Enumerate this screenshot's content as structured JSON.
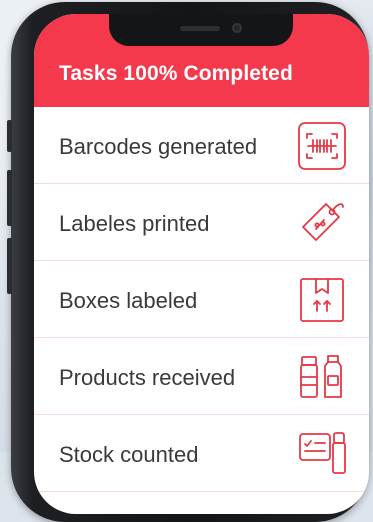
{
  "header": {
    "title": "Tasks 100% Completed"
  },
  "tasks": [
    {
      "label": "Barcodes generated",
      "icon": "barcode-scan-icon"
    },
    {
      "label": "Labeles printed",
      "icon": "price-tag-icon"
    },
    {
      "label": "Boxes labeled",
      "icon": "labeled-box-icon"
    },
    {
      "label": "Products received",
      "icon": "product-packages-icon"
    },
    {
      "label": "Stock counted",
      "icon": "inventory-count-icon"
    }
  ],
  "colors": {
    "accent": "#f3394b",
    "text": "#3a3a3a",
    "divider": "#f1dcd6",
    "icon_stroke": "#e53945"
  }
}
